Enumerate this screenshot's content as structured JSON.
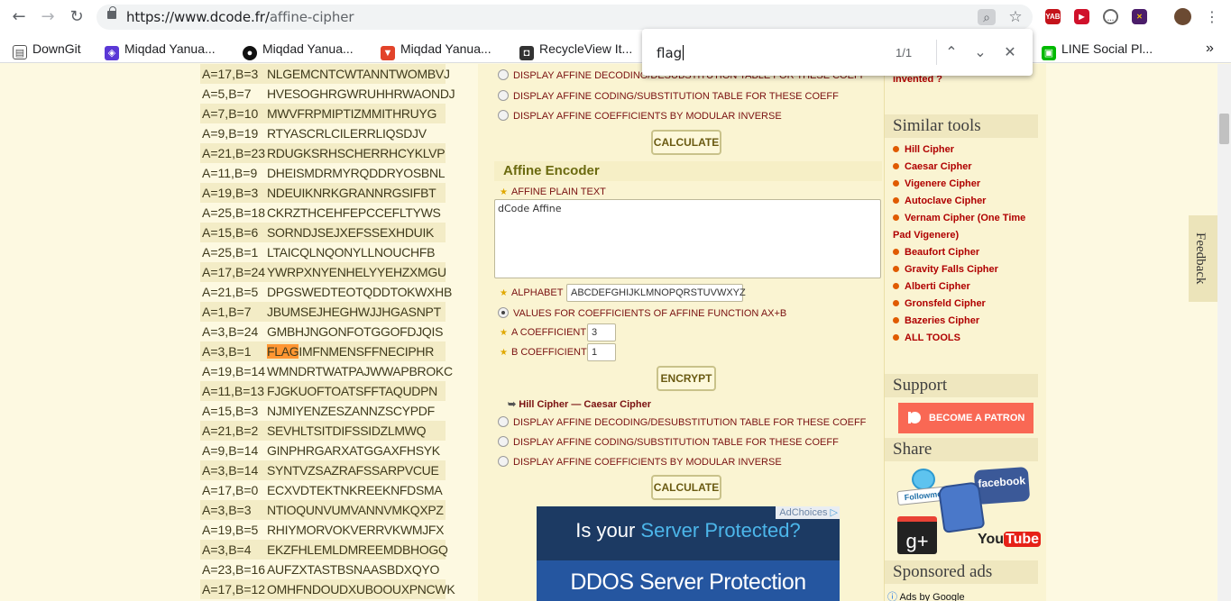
{
  "browser": {
    "url_host": "https://www.dcode.fr/",
    "url_path": "affine-cipher",
    "back_label": "←",
    "forward_label": "→",
    "reload_label": "↻",
    "bookmarks": [
      {
        "label": "DownGit",
        "icon": "folder-icon"
      },
      {
        "label": "Miqdad Yanua...",
        "icon": "shield-icon"
      },
      {
        "label": "Miqdad Yanua...",
        "icon": "github-icon"
      },
      {
        "label": "Miqdad Yanua...",
        "icon": "gitlab-icon"
      },
      {
        "label": "RecycleView It...",
        "icon": "bookmark-icon"
      },
      {
        "label": "LINE Social Pl...",
        "icon": "line-icon"
      }
    ],
    "more_bookmarks": "»",
    "ext_labels": [
      "YAB"
    ]
  },
  "find": {
    "query": "flag",
    "count": "1/1",
    "prev": "⌃",
    "next": "⌄",
    "close": "✕"
  },
  "results": [
    {
      "key": "A=17,B=3",
      "val": "NLGEMCNTCWTANNTWOMBVJ"
    },
    {
      "key": "A=5,B=7",
      "val": "HVESOGHRGWRUHHRWAONDJ"
    },
    {
      "key": "A=7,B=10",
      "val": "MWVFRPMIPTIZMMITHRUYG"
    },
    {
      "key": "A=9,B=19",
      "val": "RTYASCRLCILERRLIQSDJV"
    },
    {
      "key": "A=21,B=23",
      "val": "RDUGKSRHSCHERRHCYKLVP"
    },
    {
      "key": "A=11,B=9",
      "val": "DHEISMDRMYRQDDRYOSBNL"
    },
    {
      "key": "A=19,B=3",
      "val": "NDEUIKNRKGRANNRGSIFBT"
    },
    {
      "key": "A=25,B=18",
      "val": "CKRZTHCEHFEPCCEFLTYWS"
    },
    {
      "key": "A=15,B=6",
      "val": "SORNDJSEJXEFSSEXHDUIK"
    },
    {
      "key": "A=25,B=1",
      "val": "LTAICQLNQONYLLNOUCHFB"
    },
    {
      "key": "A=17,B=24",
      "val": "YWRPXNYENHELYYEHZXMGU"
    },
    {
      "key": "A=21,B=5",
      "val": "DPGSWEDTEOTQDDTOKWXHB"
    },
    {
      "key": "A=1,B=7",
      "val": "JBUMSEJHEGHWJJHGASNPT"
    },
    {
      "key": "A=3,B=24",
      "val": "GMBHJNGONFOTGGOFDJQIS"
    },
    {
      "key": "A=3,B=1",
      "val_hl": "FLAG",
      "val": "IMFNMENSFFNECIPHR"
    },
    {
      "key": "A=19,B=14",
      "val": "WMNDRTWATPAJWWAPBROKC"
    },
    {
      "key": "A=11,B=13",
      "val": "FJGKUOFTOATSFFTAQUDPN"
    },
    {
      "key": "A=15,B=3",
      "val": "NJMIYENZESZANNZSCYPDF"
    },
    {
      "key": "A=21,B=2",
      "val": "SEVHLTSITDIFSSIDZLMWQ"
    },
    {
      "key": "A=9,B=14",
      "val": "GINPHRGARXATGGAXFHSYK"
    },
    {
      "key": "A=3,B=14",
      "val": "SYNTVZSAZRAFSSARPVCUE"
    },
    {
      "key": "A=17,B=0",
      "val": "ECXVDTEKTNKREEKNFDSMA"
    },
    {
      "key": "A=3,B=3",
      "val": "NTIOQUNVUMVANNVMKQXPZ"
    },
    {
      "key": "A=19,B=5",
      "val": "RHIYMORVOKVERRVKWMJFX"
    },
    {
      "key": "A=3,B=4",
      "val": "EKZFHLEMLDMREEMDBHOGQ"
    },
    {
      "key": "A=23,B=16",
      "val": "AUFZXTASTBSNAASBDXQYO"
    },
    {
      "key": "A=17,B=12",
      "val": "OMHFNDOUDXUBOOUXPNCWK"
    }
  ],
  "decoder_options": [
    "DISPLAY AFFINE DECODING/DESUBSTITUTION TABLE FOR THESE COEFF",
    "DISPLAY AFFINE CODING/SUBSTITUTION TABLE FOR THESE COEFF",
    "DISPLAY AFFINE COEFFICIENTS BY MODULAR INVERSE"
  ],
  "calculate_label": "CALCULATE",
  "encoder": {
    "title": "Affine Encoder",
    "plain_label": "AFFINE PLAIN TEXT",
    "plain_value": "dCode Affine",
    "alphabet_label": "ALPHABET",
    "alphabet_value": "ABCDEFGHIJKLMNOPQRSTUVWXYZ",
    "values_label": "VALUES FOR COEFFICIENTS OF AFFINE FUNCTION AX+B",
    "a_label": "A COEFFICIENT",
    "a_value": "3",
    "b_label": "B COEFFICIENT",
    "b_value": "1",
    "encrypt_label": "ENCRYPT",
    "link_arrow": "➥",
    "link_1": "Hill Cipher",
    "link_sep": " — ",
    "link_2": "Caesar Cipher",
    "options": [
      "DISPLAY AFFINE DECODING/DESUBSTITUTION TABLE FOR THESE COEFF",
      "DISPLAY AFFINE CODING/SUBSTITUTION TABLE FOR THESE COEFF",
      "DISPLAY AFFINE COEFFICIENTS BY MODULAR INVERSE"
    ]
  },
  "ad": {
    "choices": "AdChoices",
    "headline_1": "Is your ",
    "headline_2": "Server Protected?",
    "sub": "DDOS Server Protection"
  },
  "sidebar": {
    "invented": "invented ?",
    "similar_title": "Similar tools",
    "tools": [
      "Hill Cipher",
      "Caesar Cipher",
      "Vigenere Cipher",
      "Autoclave Cipher",
      "Vernam Cipher (One Time",
      "Pad Vigenere)",
      "Beaufort Cipher",
      "Gravity Falls Cipher",
      "Alberti Cipher",
      "Gronsfeld Cipher",
      "Bazeries Cipher",
      "ALL TOOLS"
    ],
    "support_title": "Support",
    "patron_label": "BECOME A PATRON",
    "share_title": "Share",
    "followme": "Followme!",
    "facebook": "facebook",
    "gplus": "g+",
    "youtube_1": "You",
    "youtube_2": "Tube",
    "sponsored_title": "Sponsored ads",
    "ads_by": "Ads by Google"
  },
  "feedback_label": "Feedback",
  "colors": {
    "highlight": "#ff9632",
    "tool_red": "#b00000",
    "patron": "#f96854"
  }
}
